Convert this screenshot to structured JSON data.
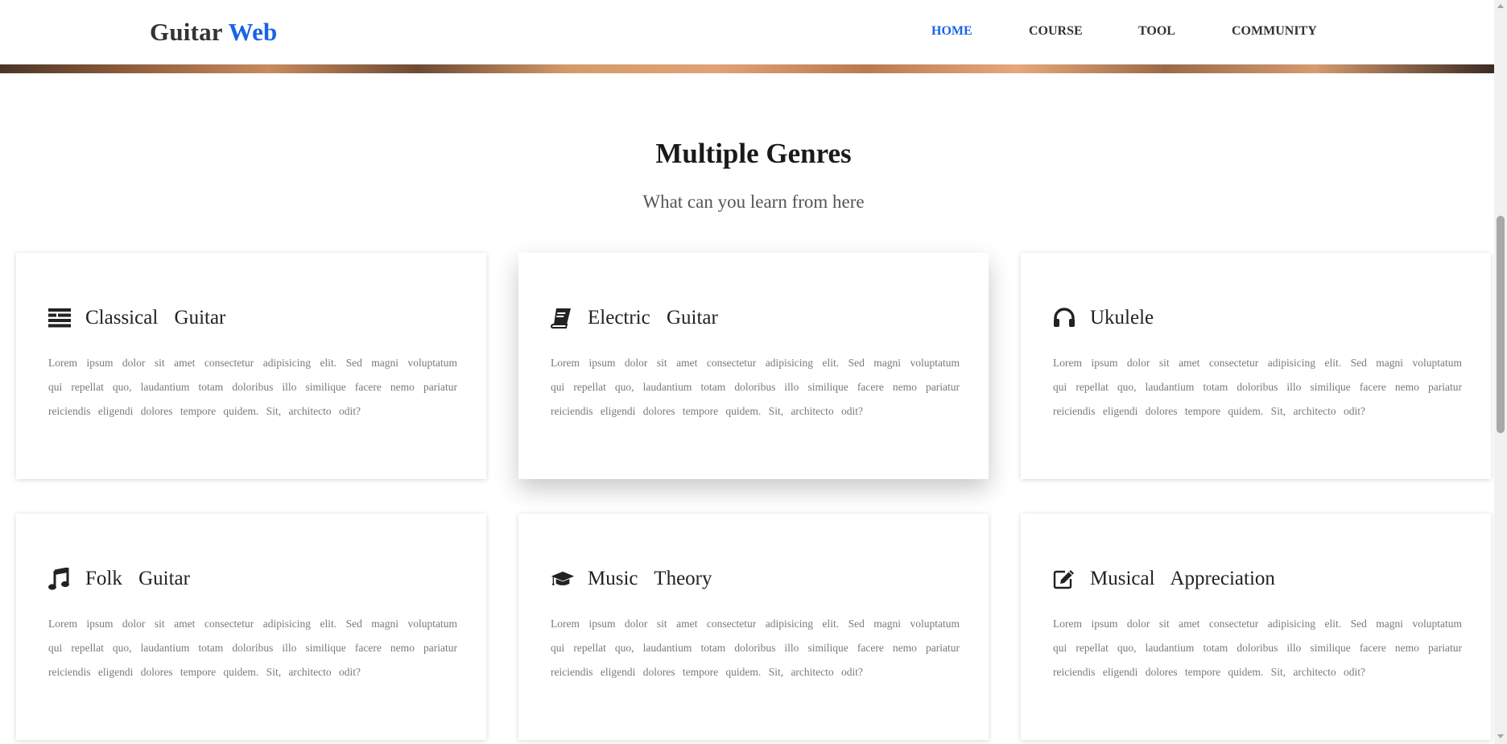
{
  "header": {
    "logo_main": "Guitar",
    "logo_accent": "Web",
    "nav": [
      "HOME",
      "COURSE",
      "TOOL",
      "COMMUNITY"
    ],
    "active_nav": "HOME",
    "accent_color": "#1a63e8"
  },
  "section": {
    "title": "Multiple Genres",
    "subtitle": "What can you learn from here"
  },
  "cards": [
    {
      "icon": "align-left-icon",
      "title": "Classical Guitar",
      "text": "Lorem ipsum dolor sit amet consectetur adipisicing elit. Sed magni voluptatum qui repellat quo, laudantium totam doloribus illo similique facere nemo pariatur reiciendis eligendi dolores tempore quidem. Sit, architecto odit?"
    },
    {
      "icon": "book-icon",
      "title": "Electric Guitar",
      "text": "Lorem ipsum dolor sit amet consectetur adipisicing elit. Sed magni voluptatum qui repellat quo, laudantium totam doloribus illo similique facere nemo pariatur reiciendis eligendi dolores tempore quidem. Sit, architecto odit?"
    },
    {
      "icon": "headphones-icon",
      "title": "Ukulele",
      "text": "Lorem ipsum dolor sit amet consectetur adipisicing elit. Sed magni voluptatum qui repellat quo, laudantium totam doloribus illo similique facere nemo pariatur reiciendis eligendi dolores tempore quidem. Sit, architecto odit?"
    },
    {
      "icon": "music-note-icon",
      "title": "Folk Guitar",
      "text": "Lorem ipsum dolor sit amet consectetur adipisicing elit. Sed magni voluptatum qui repellat quo, laudantium totam doloribus illo similique facere nemo pariatur reiciendis eligendi dolores tempore quidem. Sit, architecto odit?"
    },
    {
      "icon": "graduation-cap-icon",
      "title": "Music Theory",
      "text": "Lorem ipsum dolor sit amet consectetur adipisicing elit. Sed magni voluptatum qui repellat quo, laudantium totam doloribus illo similique facere nemo pariatur reiciendis eligendi dolores tempore quidem. Sit, architecto odit?"
    },
    {
      "icon": "edit-icon",
      "title": "Musical Appreciation",
      "text": "Lorem ipsum dolor sit amet consectetur adipisicing elit. Sed magni voluptatum qui repellat quo, laudantium totam doloribus illo similique facere nemo pariatur reiciendis eligendi dolores tempore quidem. Sit, architecto odit?"
    }
  ]
}
